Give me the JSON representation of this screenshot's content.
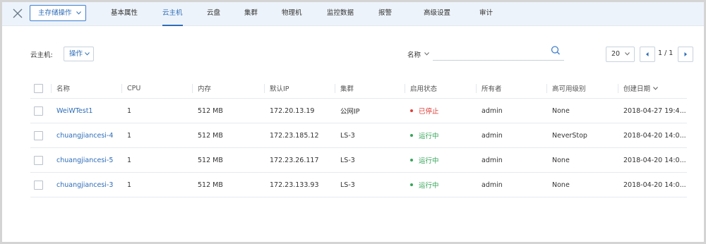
{
  "topbar": {
    "storage_button": "主存储操作",
    "tabs": [
      "基本属性",
      "云主机",
      "云盘",
      "集群",
      "物理机",
      "监控数据",
      "报警",
      "高级设置",
      "审计"
    ],
    "active_tab": "云主机"
  },
  "toolbar": {
    "label": "云主机:",
    "ops_button": "操作",
    "filter_label": "名称",
    "search_value": "",
    "page_size": "20",
    "page_info": "1 / 1"
  },
  "table": {
    "headers": [
      "名称",
      "CPU",
      "内存",
      "默认IP",
      "集群",
      "启用状态",
      "所有者",
      "高可用级别",
      "创建日期"
    ],
    "rows": [
      {
        "name": "WeiWTest1",
        "cpu": "1",
        "memory": "512 MB",
        "ip": "172.20.13.19",
        "cluster": "公网IP",
        "status": "已停止",
        "status_kind": "stopped",
        "owner": "admin",
        "ha": "None",
        "created": "2018-04-27 19:4..."
      },
      {
        "name": "chuangjiancesi-4",
        "cpu": "1",
        "memory": "512 MB",
        "ip": "172.23.185.12",
        "cluster": "LS-3",
        "status": "运行中",
        "status_kind": "running",
        "owner": "admin",
        "ha": "NeverStop",
        "created": "2018-04-20 14:0..."
      },
      {
        "name": "chuangjiancesi-5",
        "cpu": "1",
        "memory": "512 MB",
        "ip": "172.23.26.117",
        "cluster": "LS-3",
        "status": "运行中",
        "status_kind": "running",
        "owner": "admin",
        "ha": "None",
        "created": "2018-04-20 14:0..."
      },
      {
        "name": "chuangjiancesi-3",
        "cpu": "1",
        "memory": "512 MB",
        "ip": "172.23.133.93",
        "cluster": "LS-3",
        "status": "运行中",
        "status_kind": "running",
        "owner": "admin",
        "ha": "None",
        "created": "2018-04-20 14:0..."
      }
    ]
  },
  "colors": {
    "accent": "#2e6db8",
    "stopped": "#e0413b",
    "running": "#36a55a"
  },
  "icons": [
    "close-icon",
    "chevron-down-icon",
    "search-icon",
    "chevron-left-icon",
    "chevron-right-icon"
  ]
}
